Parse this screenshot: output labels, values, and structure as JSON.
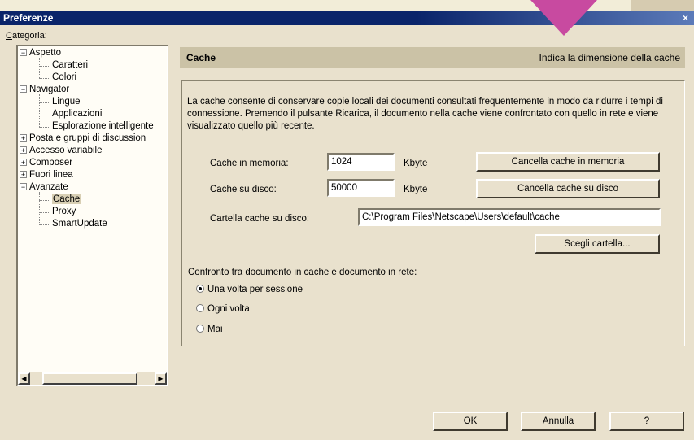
{
  "window": {
    "title": "Preferenze",
    "close_glyph": "×"
  },
  "categories": {
    "label": "Categoria:",
    "tree": [
      {
        "label": "Aspetto",
        "level": 0,
        "expander": "−"
      },
      {
        "label": "Caratteri",
        "level": 1
      },
      {
        "label": "Colori",
        "level": 1
      },
      {
        "label": "Navigator",
        "level": 0,
        "expander": "−"
      },
      {
        "label": "Lingue",
        "level": 1
      },
      {
        "label": "Applicazioni",
        "level": 1
      },
      {
        "label": "Esplorazione intelligente",
        "level": 1
      },
      {
        "label": "Posta e gruppi di discussion",
        "level": 0,
        "expander": "+"
      },
      {
        "label": "Accesso variabile",
        "level": 0,
        "expander": "+"
      },
      {
        "label": "Composer",
        "level": 0,
        "expander": "+"
      },
      {
        "label": "Fuori linea",
        "level": 0,
        "expander": "+"
      },
      {
        "label": "Avanzate",
        "level": 0,
        "expander": "−"
      },
      {
        "label": "Cache",
        "level": 1,
        "selected": true
      },
      {
        "label": "Proxy",
        "level": 1
      },
      {
        "label": "SmartUpdate",
        "level": 1
      }
    ],
    "scroll_left": "◀",
    "scroll_right": "▶"
  },
  "section": {
    "title": "Cache",
    "description": "Indica la dimensione della cache"
  },
  "panel": {
    "intro": "La cache consente di conservare copie locali dei documenti consultati frequentemente in modo da ridurre i tempi di connessione. Premendo il pulsante Ricarica, il documento nella cache viene confrontato con quello in rete e viene visualizzato quello più recente.",
    "memory_label": "Cache in memoria:",
    "memory_value": "1024",
    "memory_unit": "Kbyte",
    "clear_memory_button": "Cancella cache in memoria",
    "disk_label": "Cache su disco:",
    "disk_value": "50000",
    "disk_unit": "Kbyte",
    "clear_disk_button": "Cancella cache su disco",
    "folder_label": "Cartella cache su disco:",
    "folder_value": "C:\\Program Files\\Netscape\\Users\\default\\cache",
    "choose_folder_button": "Scegli cartella...",
    "compare_label": "Confronto tra documento in cache e documento in rete:",
    "compare_options": [
      {
        "label": "Una volta per sessione",
        "selected": true
      },
      {
        "label": "Ogni volta",
        "selected": false
      },
      {
        "label": "Mai",
        "selected": false
      }
    ]
  },
  "footer": {
    "ok": "OK",
    "cancel": "Annulla",
    "help": "?"
  },
  "colors": {
    "accent_arrow": "#c84aa0",
    "titlebar": "#0a246a",
    "dialog_bg": "#e9e1cd"
  }
}
